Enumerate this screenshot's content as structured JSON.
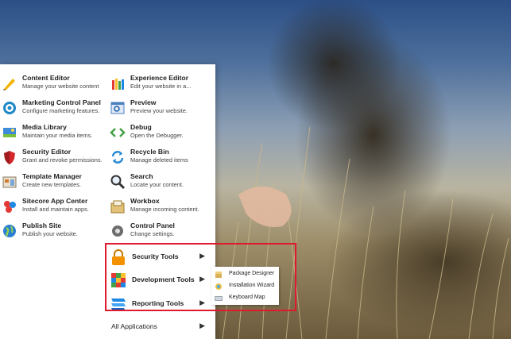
{
  "left_items": [
    {
      "title": "Content Editor",
      "desc": "Manage your website content",
      "icon": "pencil-icon"
    },
    {
      "title": "Marketing Control Panel",
      "desc": "Configure marketing features.",
      "icon": "target-icon"
    },
    {
      "title": "Media Library",
      "desc": "Maintain your media items.",
      "icon": "media-library-icon"
    },
    {
      "title": "Security Editor",
      "desc": "Grant and revoke permissions.",
      "icon": "shield-icon"
    },
    {
      "title": "Template Manager",
      "desc": "Create new templates.",
      "icon": "template-icon"
    },
    {
      "title": "Sitecore App Center",
      "desc": "Install and maintain apps.",
      "icon": "app-center-icon"
    },
    {
      "title": "Publish Site",
      "desc": "Publish your website.",
      "icon": "globe-icon"
    }
  ],
  "right_items": [
    {
      "title": "Experience Editor",
      "desc": "Edit your website in a...",
      "icon": "experience-editor-icon"
    },
    {
      "title": "Preview",
      "desc": "Preview your website.",
      "icon": "preview-icon"
    },
    {
      "title": "Debug",
      "desc": "Open the Debugger.",
      "icon": "debug-icon"
    },
    {
      "title": "Recycle Bin",
      "desc": "Manage deleted items",
      "icon": "recycle-icon"
    },
    {
      "title": "Search",
      "desc": "Locate your content.",
      "icon": "search-icon"
    },
    {
      "title": "Workbox",
      "desc": "Manage incoming content.",
      "icon": "workbox-icon"
    },
    {
      "title": "Control Panel",
      "desc": "Change settings.",
      "icon": "control-panel-icon"
    }
  ],
  "submenus": [
    {
      "label": "Security Tools",
      "icon": "lock-icon",
      "arrow": "▶"
    },
    {
      "label": "Development Tools",
      "icon": "blocks-icon",
      "arrow": "▶"
    },
    {
      "label": "Reporting Tools",
      "icon": "report-icon",
      "arrow": "▶"
    }
  ],
  "all_applications": {
    "label": "All Applications",
    "arrow": "▶"
  },
  "flyout": [
    {
      "label": "Package Designer",
      "icon": "package-icon"
    },
    {
      "label": "Installation Wizard",
      "icon": "wizard-icon"
    },
    {
      "label": "Keyboard Map",
      "icon": "keyboard-icon"
    }
  ],
  "colors": {
    "highlight": "#e01a2e",
    "menu_bg": "#ffffff"
  }
}
